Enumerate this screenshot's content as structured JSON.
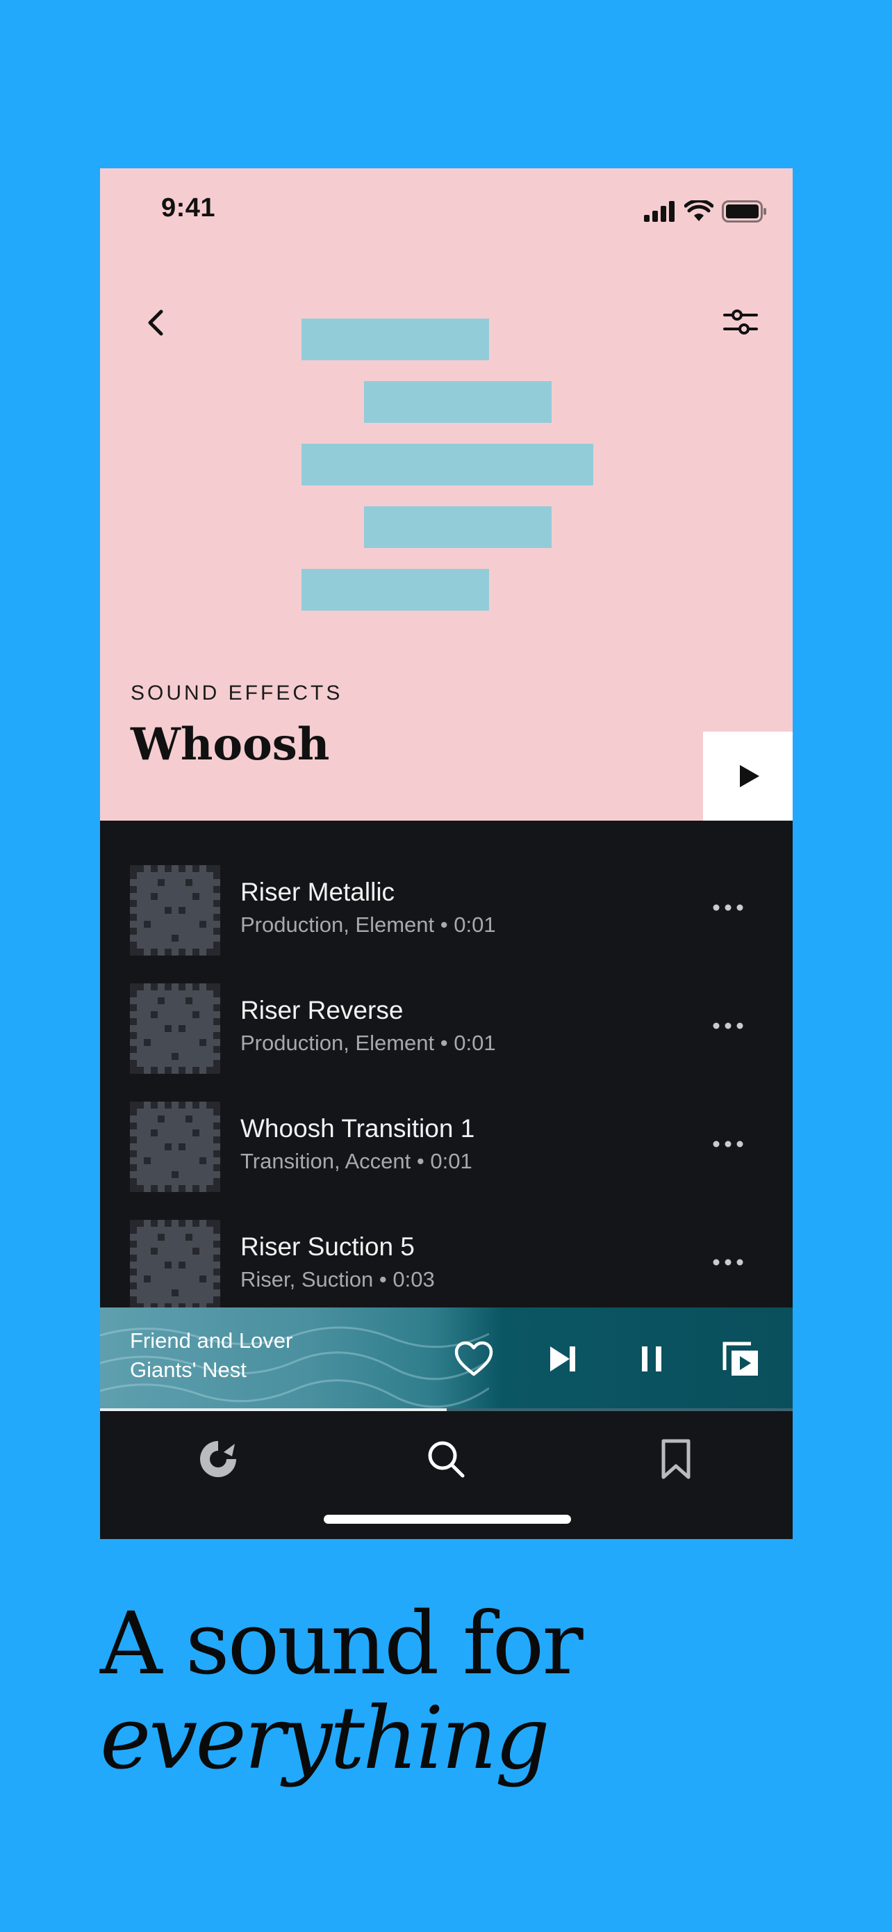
{
  "status_bar": {
    "time": "9:41"
  },
  "header": {
    "category": "SOUND EFFECTS",
    "title": "Whoosh"
  },
  "tracks": [
    {
      "title": "Riser Metallic",
      "tags": "Production, Element",
      "duration": "0:01"
    },
    {
      "title": "Riser Reverse",
      "tags": "Production, Element",
      "duration": "0:01"
    },
    {
      "title": "Whoosh Transition 1",
      "tags": "Transition, Accent",
      "duration": "0:01"
    },
    {
      "title": "Riser Suction 5",
      "tags": "Riser, Suction",
      "duration": "0:03"
    }
  ],
  "now_playing": {
    "title": "Friend and Lover",
    "artist": "Giants' Nest",
    "progress": 0.5
  },
  "tabs": [
    "home-icon",
    "search-icon",
    "bookmark-icon"
  ],
  "tagline": {
    "line1": "A sound for",
    "line2": "everything"
  },
  "colors": {
    "background": "#22a9fc",
    "hero": "#f5cdd0",
    "art_bars": "#93ccd9",
    "list_bg": "#141518",
    "mini_player": "#0a4f5c"
  }
}
